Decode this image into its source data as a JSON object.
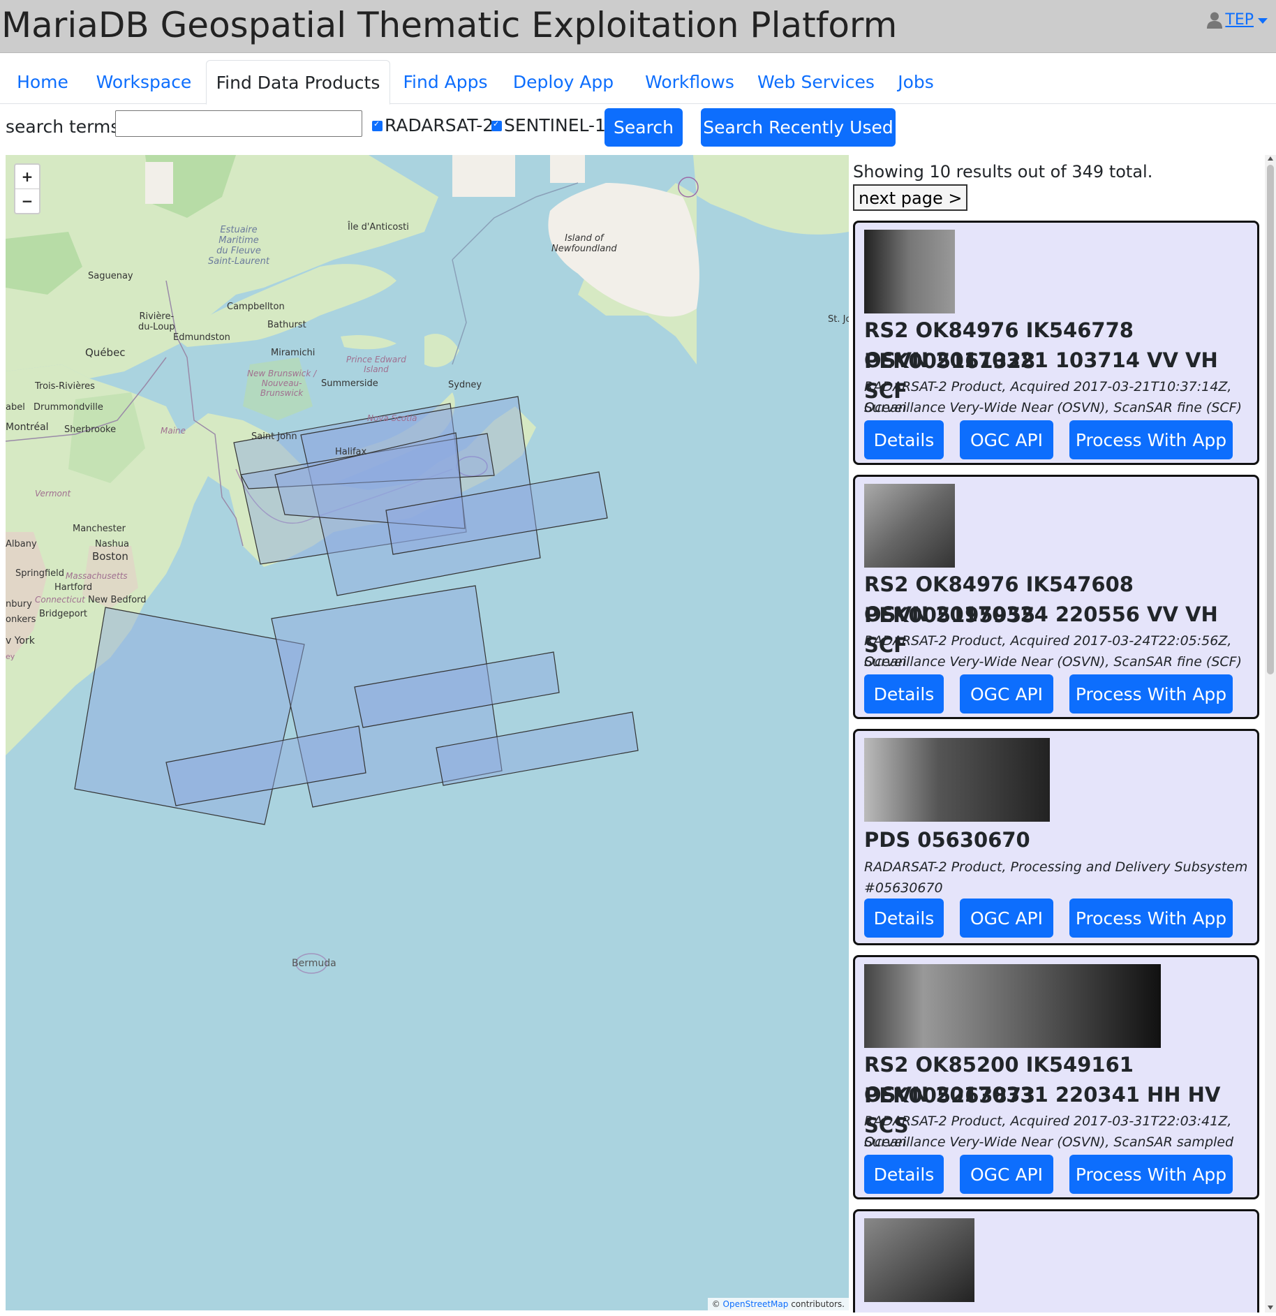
{
  "header": {
    "title": "MariaDB Geospatial Thematic Exploitation Platform",
    "user": "TEP",
    "user_icon": "user-icon"
  },
  "nav": {
    "tabs": [
      {
        "label": "Home",
        "active": false
      },
      {
        "label": "Workspace",
        "active": false
      },
      {
        "label": "Find Data Products",
        "active": true
      },
      {
        "label": "Find Apps",
        "active": false
      },
      {
        "label": "Deploy App",
        "active": false
      },
      {
        "label": "Workflows",
        "active": false
      },
      {
        "label": "Web Services",
        "active": false
      },
      {
        "label": "Jobs",
        "active": false
      }
    ]
  },
  "search": {
    "label": "search terms:",
    "value": "",
    "placeholder": "",
    "filters": [
      {
        "label": "RADARSAT-2",
        "checked": true
      },
      {
        "label": "SENTINEL-1",
        "checked": true
      }
    ],
    "search_button": "Search",
    "recent_button": "Search Recently Used"
  },
  "map": {
    "zoom_in": "+",
    "zoom_out": "−",
    "attribution_prefix": "©",
    "attribution_link": "OpenStreetMap",
    "attribution_suffix": "contributors.",
    "labels": {
      "estuaire": "Estuaire\nMaritime\ndu Fleuve\nSaint-Laurent",
      "anticosti": "Île d'Anticosti",
      "newfoundland": "Island of\nNewfoundland",
      "saguenay": "Saguenay",
      "riviere": "Rivière-\ndu-Loup",
      "campbellton": "Campbellton",
      "bathurst": "Bathurst",
      "edmundston": "Edmundston",
      "quebec": "Québec",
      "miramichi": "Miramichi",
      "pei": "Prince Edward\nIsland",
      "nb": "New Brunswick /\nNouveau-\nBrunswick",
      "summerside": "Summerside",
      "sydney": "Sydney",
      "trois": "Trois-Rivières",
      "drummondville": "Drummondville",
      "abel": "abel",
      "montreal": "Montréal",
      "sherbrooke": "Sherbrooke",
      "maine": "Maine",
      "saintjohn": "Saint John",
      "novascotia": "Nova Scotia",
      "halifax": "Halifax",
      "vermont": "Vermont",
      "manchester": "Manchester",
      "nashua": "Nashua",
      "albany": "Albany",
      "boston": "Boston",
      "springfield": "Springfield",
      "massachusetts": "Massachusetts",
      "hartford": "Hartford",
      "nbury": "nbury",
      "connecticut": "Connecticut",
      "newbedford": "New Bedford",
      "bridgeport": "Bridgeport",
      "onkers": "onkers",
      "vyork": "v York",
      "stjoh": "St. Joh",
      "bermuda": "Bermuda",
      "ey": "ey"
    }
  },
  "results": {
    "summary": "Showing 10 results out of 349 total.",
    "next_page": "next page >",
    "details_label": "Details",
    "ogc_label": "OGC API",
    "process_label": "Process With App",
    "items": [
      {
        "title_line1": "RS2 OK84976 IK546778 PEK005161328",
        "title_line2": "OSVN 20170321 103714 VV VH SCF",
        "desc_line1": "RADARSAT-2 Product, Acquired 2017-03-21T10:37:14Z, Ocean",
        "desc_line2": "Surveillance Very-Wide Near (OSVN), ScanSAR fine (SCF)"
      },
      {
        "title_line1": "RS2 OK84976 IK547608 PEK005195955",
        "title_line2": "OSVN 20170324 220556 VV VH SCF",
        "desc_line1": "RADARSAT-2 Product, Acquired 2017-03-24T22:05:56Z, Ocean",
        "desc_line2": "Surveillance Very-Wide Near (OSVN), ScanSAR fine (SCF)"
      },
      {
        "title_line1": "PDS 05630670",
        "title_line2": "",
        "desc_line1": "RADARSAT-2 Product, Processing and Delivery Subsystem",
        "desc_line2": "#05630670"
      },
      {
        "title_line1": "RS2 OK85200 IK549161 PEK005263873",
        "title_line2": "OSVN 20170331 220341 HH HV SCS",
        "desc_line1": "RADARSAT-2 Product, Acquired 2017-03-31T22:03:41Z, Ocean",
        "desc_line2": "Surveillance Very-Wide Near (OSVN), ScanSAR sampled (SCS)"
      }
    ]
  },
  "colors": {
    "accent": "#0d6efd",
    "card_bg": "#e5e4fa",
    "water": "#aad3df",
    "land": "#d6e9c3",
    "footprint": "#8fa8e0"
  }
}
